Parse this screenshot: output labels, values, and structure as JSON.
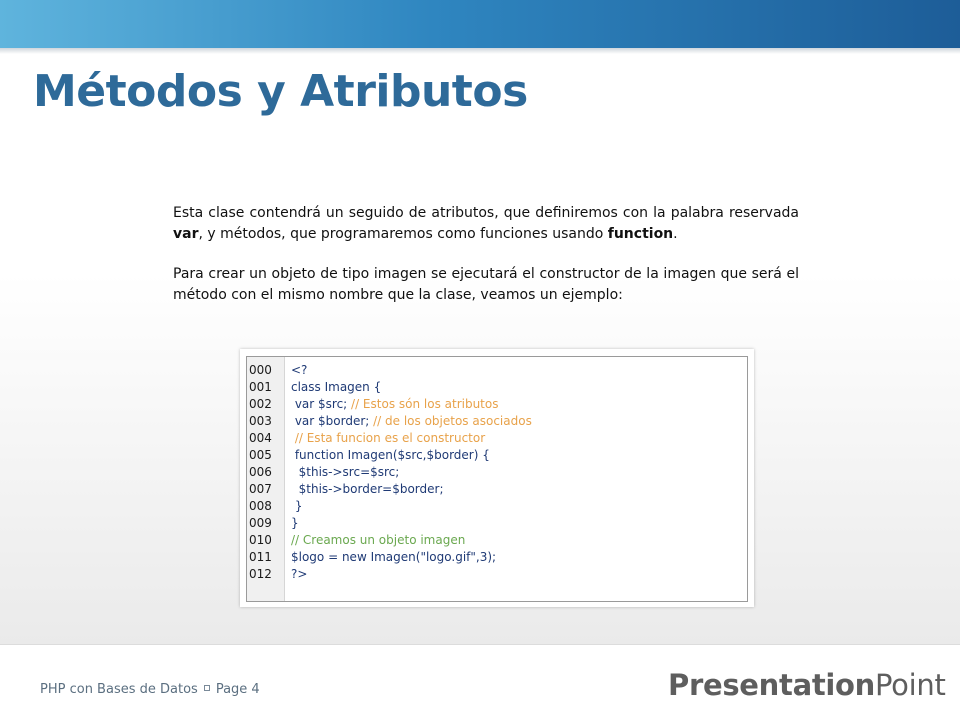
{
  "slide": {
    "title": "Métodos y Atributos",
    "paragraph1": {
      "text1": "Esta clase contendrá un seguido de atributos, que definiremos con la palabra reservada ",
      "bold1": "var",
      "text2": ", y métodos, que programaremos como funciones usando ",
      "bold2": "function",
      "text3": "."
    },
    "paragraph2": "Para crear un objeto de tipo imagen se ejecutará el constructor de la imagen que será el método con el mismo nombre que la clase, veamos un ejemplo:"
  },
  "code": {
    "line_numbers": [
      "000",
      "001",
      "002",
      "003",
      "004",
      "005",
      "006",
      "007",
      "008",
      "009",
      "010",
      "011",
      "012"
    ],
    "lines": [
      {
        "code": "<?",
        "comment": ""
      },
      {
        "code": "class Imagen {",
        "comment": ""
      },
      {
        "code": " var $src; ",
        "comment": "// Estos són los atributos"
      },
      {
        "code": " var $border; ",
        "comment": "// de los objetos asociados"
      },
      {
        "code": " ",
        "comment": "// Esta funcion es el constructor"
      },
      {
        "code": " function Imagen($src,$border) {",
        "comment": ""
      },
      {
        "code": "  $this->src=$src;",
        "comment": ""
      },
      {
        "code": "  $this->border=$border;",
        "comment": ""
      },
      {
        "code": " }",
        "comment": ""
      },
      {
        "code": "}",
        "comment": ""
      },
      {
        "code": "",
        "comment_green": "// Creamos un objeto imagen"
      },
      {
        "code": "$logo = new Imagen(\"logo.gif\",3);",
        "comment": ""
      },
      {
        "code": "?>",
        "comment": ""
      }
    ]
  },
  "footer": {
    "course": "PHP con Bases de Datos",
    "page": "Page 4",
    "logo_bold": "Presentation",
    "logo_regular": "Point"
  }
}
